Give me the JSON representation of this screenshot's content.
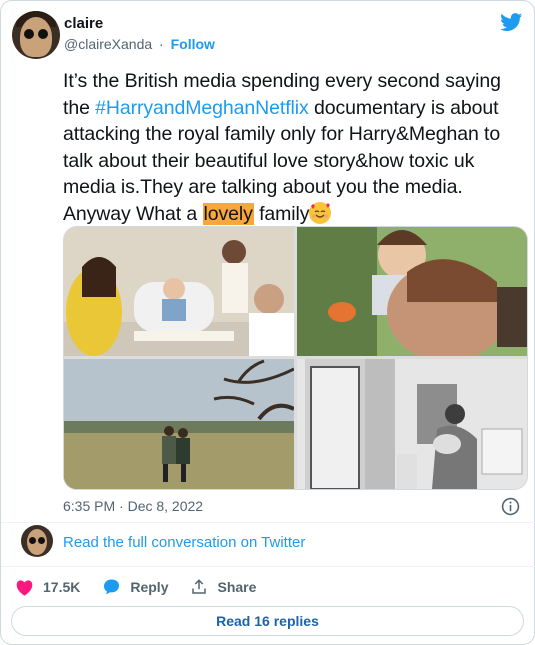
{
  "author": {
    "name": "claire",
    "handle": "@claireXanda",
    "separator": "·",
    "follow_label": "Follow"
  },
  "tweet": {
    "text_part1": "It’s the British media spending every second saying the ",
    "hashtag": "#HarryandMeghanNetflix",
    "text_part2": " documentary is about attacking the royal family only for Harry&Meghan to talk about their beautiful love story&how toxic uk media is.They are talking about you the media. Anyway What a ",
    "highlight": "lovely",
    "text_part3": " family",
    "emoji": "smiling-face-with-hearts"
  },
  "media": {
    "photos": [
      "family-birthday-photo",
      "child-and-man-outdoors-photo",
      "couple-in-field-photo",
      "woman-holding-baby-photo"
    ]
  },
  "timestamp": "6:35 PM · Dec 8, 2022",
  "conversation_link": "Read the full conversation on Twitter",
  "actions": {
    "likes_count": "17.5K",
    "reply_label": "Reply",
    "share_label": "Share"
  },
  "read_replies_label": "Read 16 replies",
  "colors": {
    "accent": "#1d9bf0",
    "like": "#f91880",
    "highlight": "#f7a73b"
  }
}
